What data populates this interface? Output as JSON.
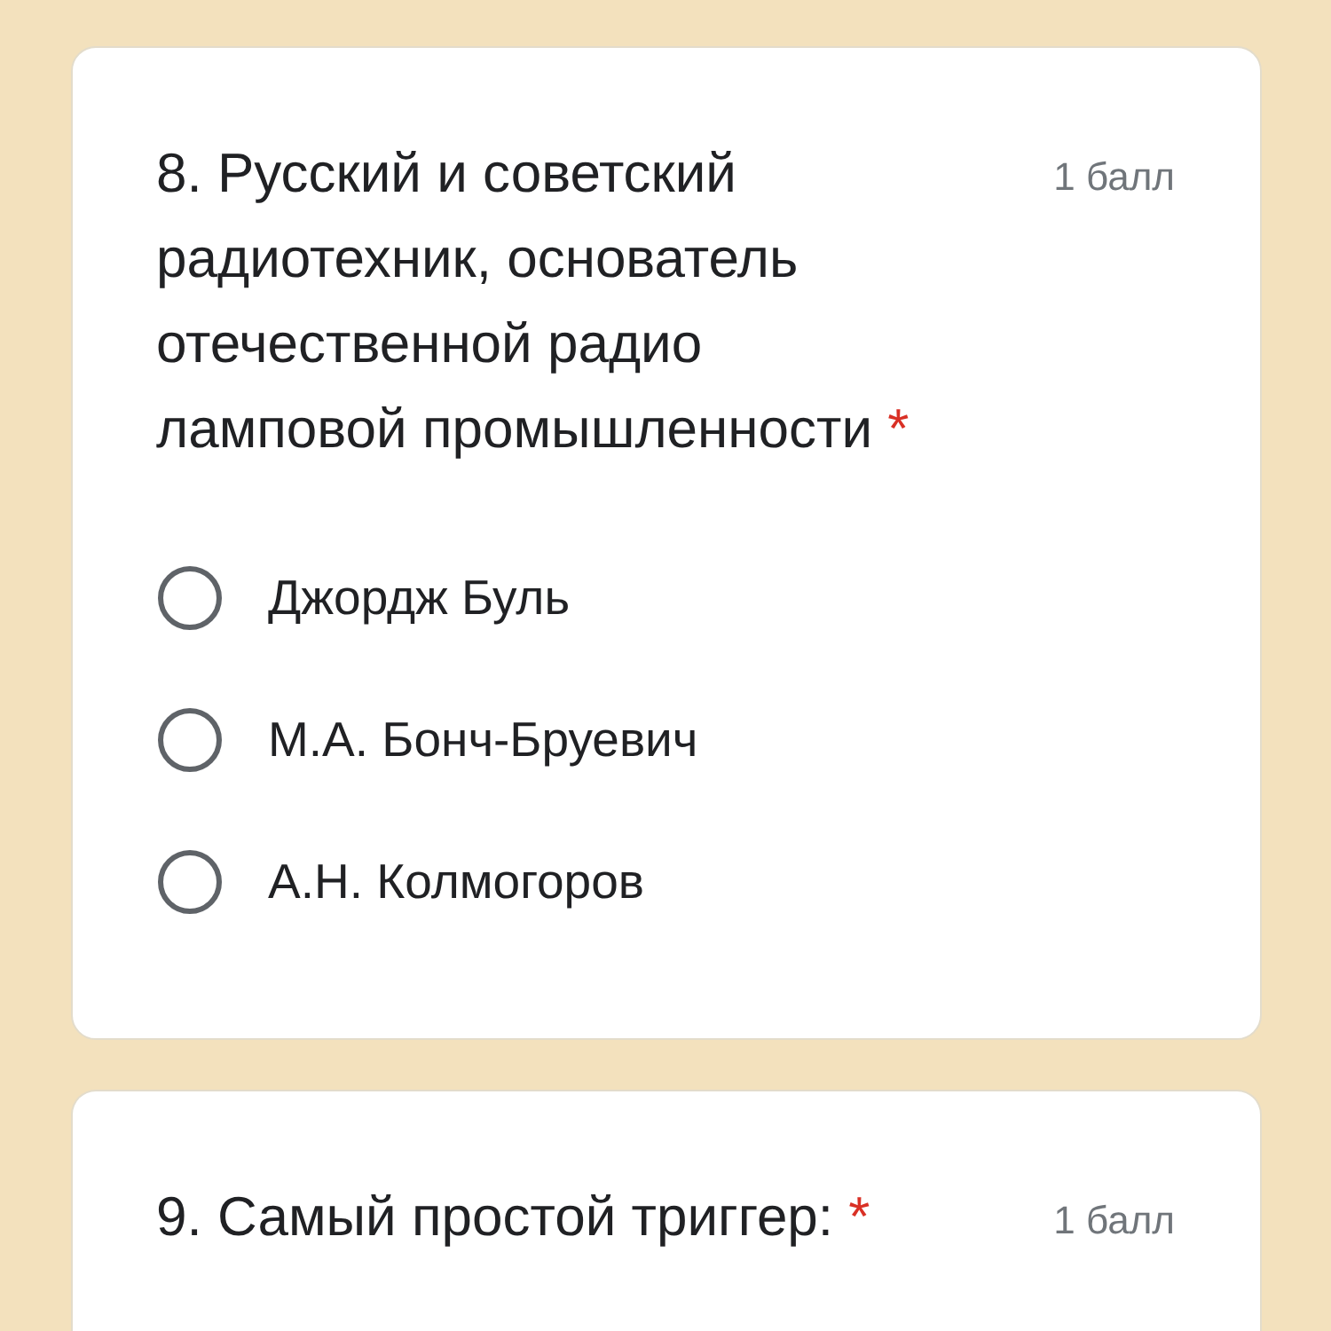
{
  "questions": [
    {
      "title": "8. Русский и советский радиотехник, основатель отечественной радио ламповой промышленности",
      "required_mark": "*",
      "points": "1 балл",
      "options": [
        {
          "label": "Джордж Буль",
          "selected": false
        },
        {
          "label": "М.А. Бонч-Бруевич",
          "selected": false
        },
        {
          "label": "А.Н. Колмогоров",
          "selected": false
        }
      ]
    },
    {
      "title": "9. Самый простой триггер:",
      "required_mark": "*",
      "points": "1 балл"
    }
  ]
}
